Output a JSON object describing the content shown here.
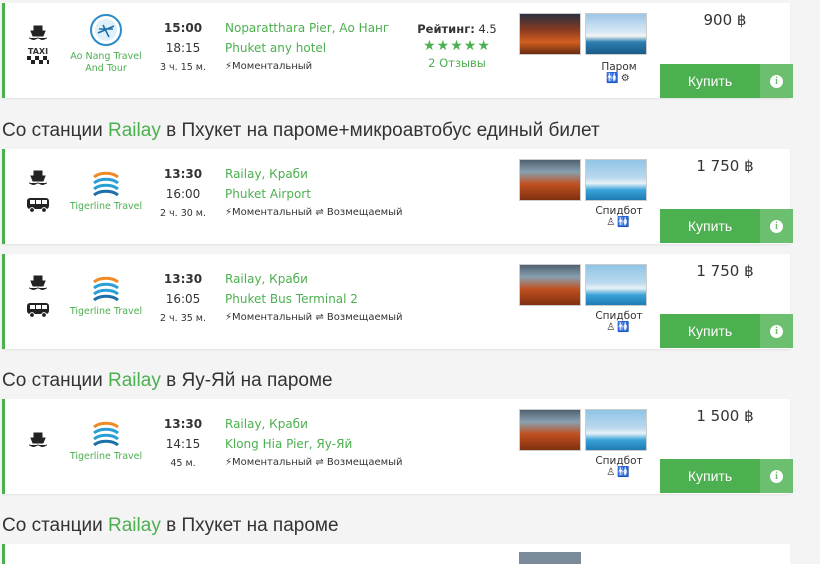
{
  "cards": [
    {
      "operator": "Ao Nang Travel And Tour",
      "depart": "15:00",
      "arrive": "18:15",
      "duration": "3 ч. 15 м.",
      "from": "Noparatthara Pier, Ао Нанг",
      "to": "Phuket any hotel",
      "flags": "Моментальный",
      "rating_label": "Рейтинг:",
      "rating_value": "4.5",
      "stars": "★★★★★",
      "reviews": "2 Отзывы",
      "vessel": "Паром",
      "price": "900 ฿",
      "buy": "Купить"
    },
    {
      "operator": "Tigerline Travel",
      "depart": "13:30",
      "arrive": "16:00",
      "duration": "2 ч. 30 м.",
      "from": "Railay, Краби",
      "to": "Phuket Airport",
      "flags": "Моментальный ⇌ Возмещаемый",
      "vessel": "Спидбот",
      "price": "1 750 ฿",
      "buy": "Купить"
    },
    {
      "operator": "Tigerline Travel",
      "depart": "13:30",
      "arrive": "16:05",
      "duration": "2 ч. 35 м.",
      "from": "Railay, Краби",
      "to": "Phuket Bus Terminal 2",
      "flags": "Моментальный ⇌ Возмещаемый",
      "vessel": "Спидбот",
      "price": "1 750 ฿",
      "buy": "Купить"
    },
    {
      "operator": "Tigerline Travel",
      "depart": "13:30",
      "arrive": "14:15",
      "duration": "45 м.",
      "from": "Railay, Краби",
      "to": "Klong Hia Pier, Яу-Яй",
      "flags": "Моментальный ⇌ Возмещаемый",
      "vessel": "Спидбот",
      "price": "1 500 ฿",
      "buy": "Купить"
    }
  ],
  "sections": [
    {
      "pre": "Со станции ",
      "hl": "Railay",
      "post": " в Пхукет на пароме+микроавтобус единый билет"
    },
    {
      "pre": "Со станции ",
      "hl": "Railay",
      "post": " в Яу-Яй на пароме"
    },
    {
      "pre": "Со станции ",
      "hl": "Railay",
      "post": " в Пхукет на пароме"
    }
  ],
  "taxi_label": "TAXI",
  "colors": {
    "accent": "#4caf50",
    "accent_light": "#6bbf6e"
  },
  "icons": [
    "boat-icon",
    "taxi-icon",
    "bus-icon",
    "lightning-icon",
    "refund-icon",
    "info-icon",
    "toilet-icon",
    "gear-icon",
    "lifeguard-icon"
  ]
}
